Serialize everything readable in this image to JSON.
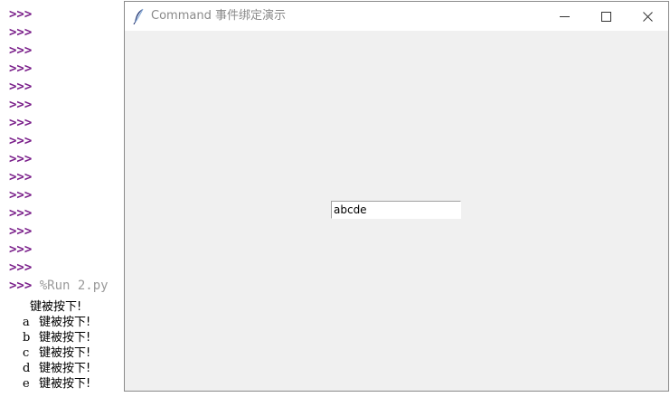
{
  "shell": {
    "prompt": ">>>",
    "empty_prompt_count": 15,
    "run_command": "%Run 2.py",
    "output": [
      {
        "key": "",
        "message": "键被按下!"
      },
      {
        "key": "a",
        "message": "键被按下!"
      },
      {
        "key": "b",
        "message": "键被按下!"
      },
      {
        "key": "c",
        "message": "键被按下!"
      },
      {
        "key": "d",
        "message": "键被按下!"
      },
      {
        "key": "e",
        "message": "键被按下!"
      }
    ]
  },
  "window": {
    "title": "Command 事件绑定演示",
    "app_icon": "feather-icon",
    "controls": {
      "minimize": "minimize-icon",
      "maximize": "maximize-icon",
      "close": "close-icon"
    },
    "entry": {
      "value": "abcde"
    }
  },
  "colors": {
    "prompt": "#7a1f8a",
    "window_bg": "#f0f0f0",
    "titlebar_bg": "#ffffff"
  }
}
